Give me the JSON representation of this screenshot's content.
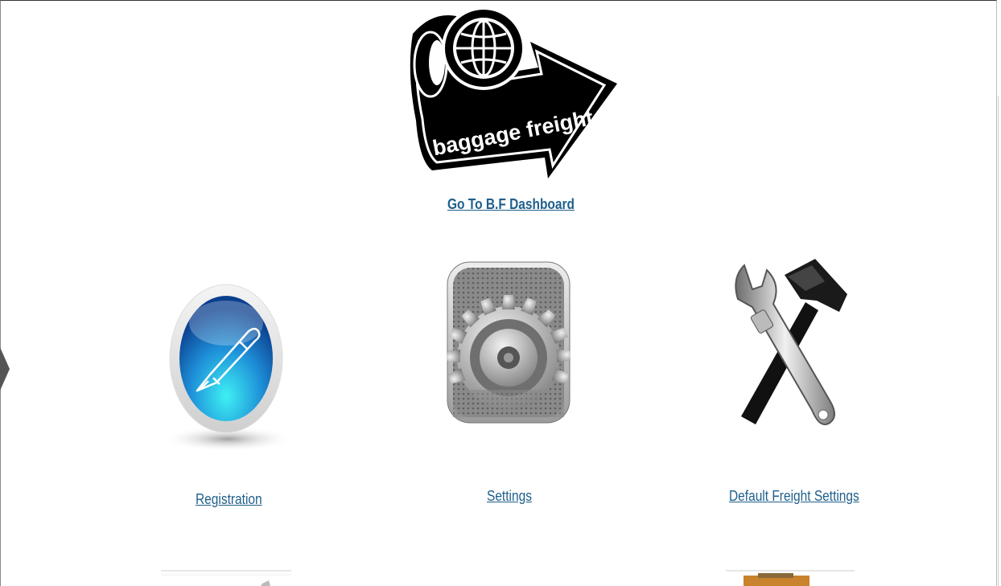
{
  "logo": {
    "text": "baggage freight",
    "icon": "globe-icon"
  },
  "dashboard_link": "Go To B.F Dashboard",
  "tiles": [
    {
      "label": "Registration",
      "icon": "pen-icon"
    },
    {
      "label": "Settings",
      "icon": "gear-icon"
    },
    {
      "label": "Default Freight Settings",
      "icon": "tools-icon"
    }
  ],
  "colors": {
    "link": "#1f5f8b",
    "background": "#ffffff"
  }
}
